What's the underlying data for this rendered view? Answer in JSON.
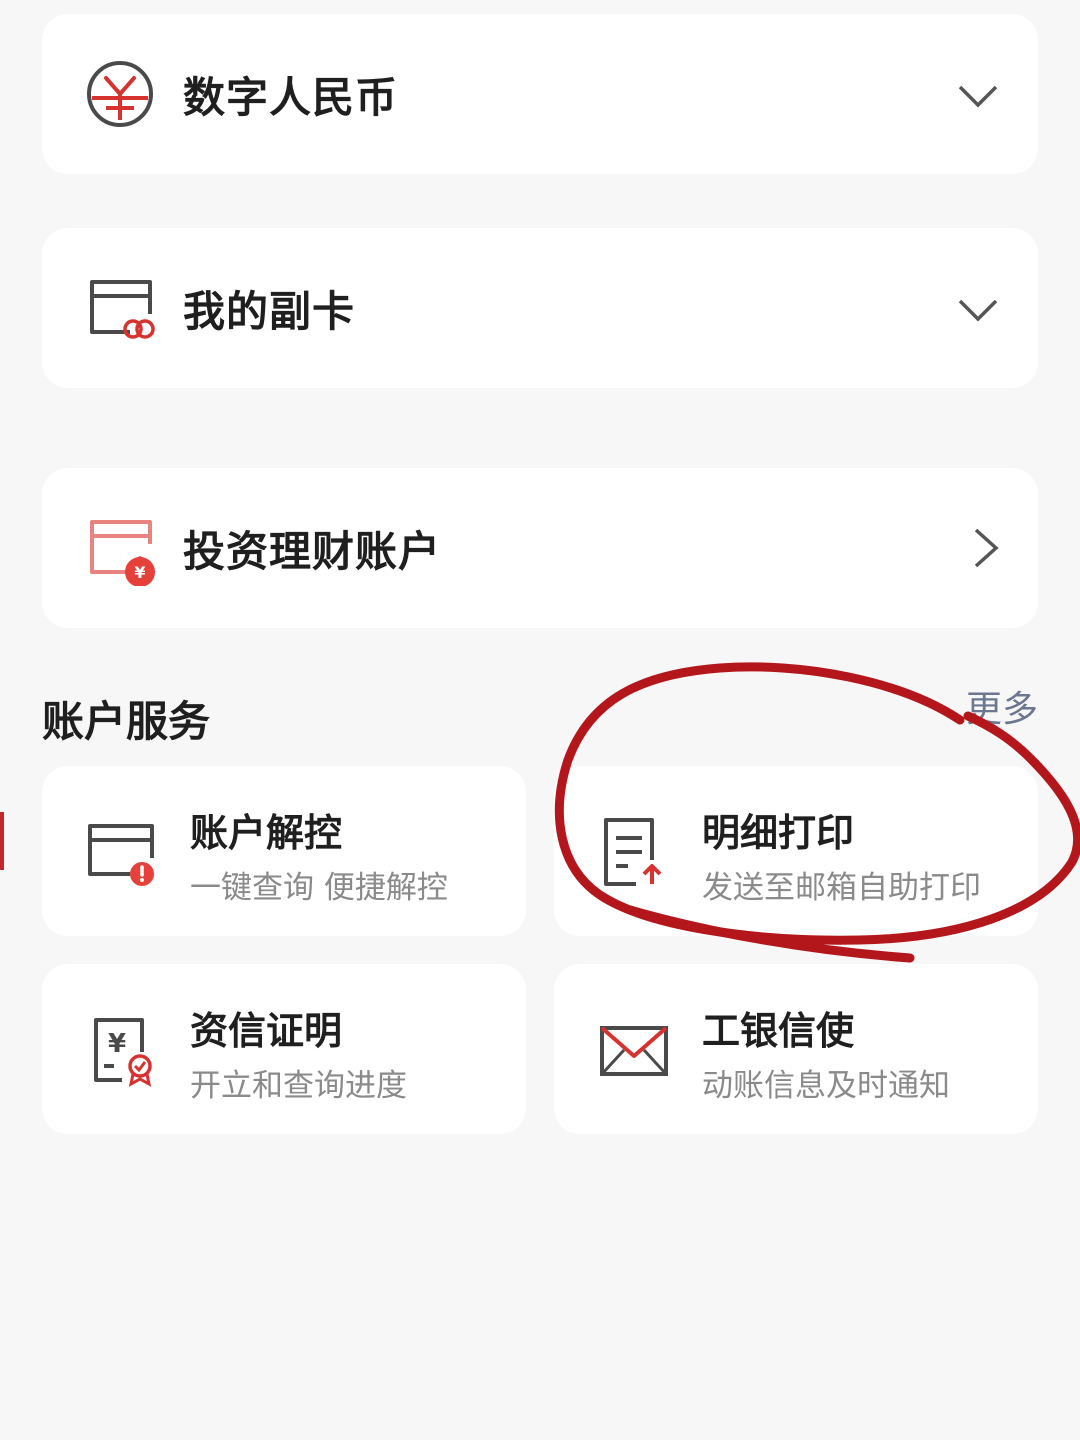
{
  "accounts": [
    {
      "label": "数字人民币",
      "icon": "digital-rmb-icon",
      "chevron": "chevron-down-icon"
    },
    {
      "label": "我的副卡",
      "icon": "sub-card-icon",
      "chevron": "chevron-down-icon"
    },
    {
      "label": "投资理财账户",
      "icon": "investment-account-icon",
      "chevron": "chevron-right-icon"
    }
  ],
  "services": {
    "title": "账户服务",
    "more_label": "更多",
    "items": [
      {
        "title": "账户解控",
        "subtitle": "一键查询 便捷解控",
        "icon": "account-unlock-icon"
      },
      {
        "title": "明细打印",
        "subtitle": "发送至邮箱自助打印",
        "icon": "statement-print-icon"
      },
      {
        "title": "资信证明",
        "subtitle": "开立和查询进度",
        "icon": "credit-certificate-icon"
      },
      {
        "title": "工银信使",
        "subtitle": "动账信息及时通知",
        "icon": "mail-envelope-icon"
      }
    ]
  },
  "colors": {
    "accent_red": "#d6322f",
    "annotation_red": "#b3161b",
    "icon_gray": "#4a4a4a",
    "background": "#f7f7f7",
    "link_gray": "#6b7690"
  }
}
